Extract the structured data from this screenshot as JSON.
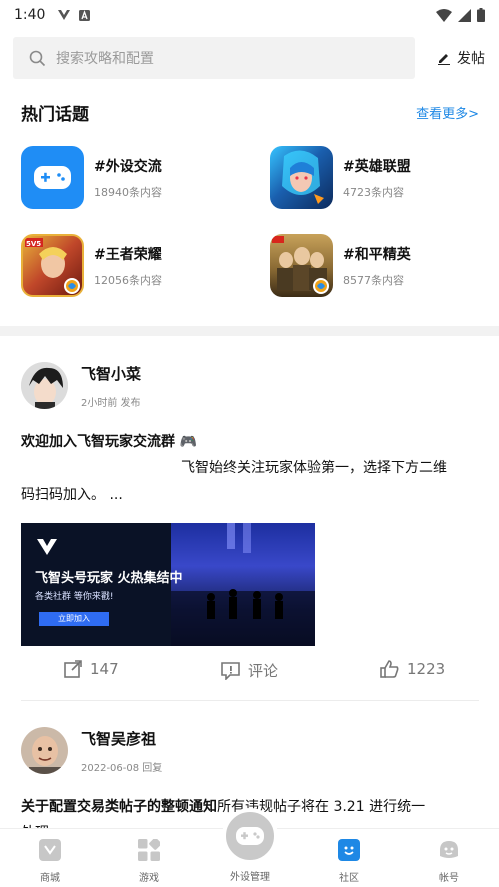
{
  "status_bar": {
    "time": "1:40"
  },
  "search": {
    "placeholder": "搜索攻略和配置",
    "post_label": "发帖"
  },
  "hot_topics": {
    "title": "热门话题",
    "see_more": "查看更多>",
    "items": [
      {
        "name": "#外设交流",
        "count": "18940条内容",
        "icon": "gamepad-icon"
      },
      {
        "name": "#英雄联盟",
        "count": "4723条内容",
        "icon": "league-of-legends-icon"
      },
      {
        "name": "#王者荣耀",
        "count": "12056条内容",
        "icon": "honor-of-kings-icon"
      },
      {
        "name": "#和平精英",
        "count": "8577条内容",
        "icon": "peace-elite-icon"
      }
    ]
  },
  "posts": [
    {
      "author": "飞智小菜",
      "meta": "2小时前 发布",
      "title": "欢迎加入飞智玩家交流群 🎮",
      "body_line1": "飞智始终关注玩家体验第一，选择下方二维",
      "body_line2": "码扫码加入。 ...",
      "banner": {
        "headline": "飞智头号玩家 火热集结中",
        "sub": "各类社群 等你来戳!",
        "button": "立即加入"
      },
      "actions": {
        "share": "147",
        "comment": "评论",
        "likes": "1223"
      }
    },
    {
      "author": "飞智吴彦祖",
      "meta": "2022-06-08 回复",
      "title": "关于配置交易类帖子的整顿通知",
      "title_tail": "所有违规帖子将在 3.21 进行统一",
      "body_line1": "处理"
    }
  ],
  "bottom_nav": {
    "items": [
      {
        "label": "商城"
      },
      {
        "label": "游戏"
      },
      {
        "label": "外设管理"
      },
      {
        "label": "社区"
      },
      {
        "label": "帐号"
      }
    ],
    "active": "社区",
    "accent": "#1e88e5"
  }
}
